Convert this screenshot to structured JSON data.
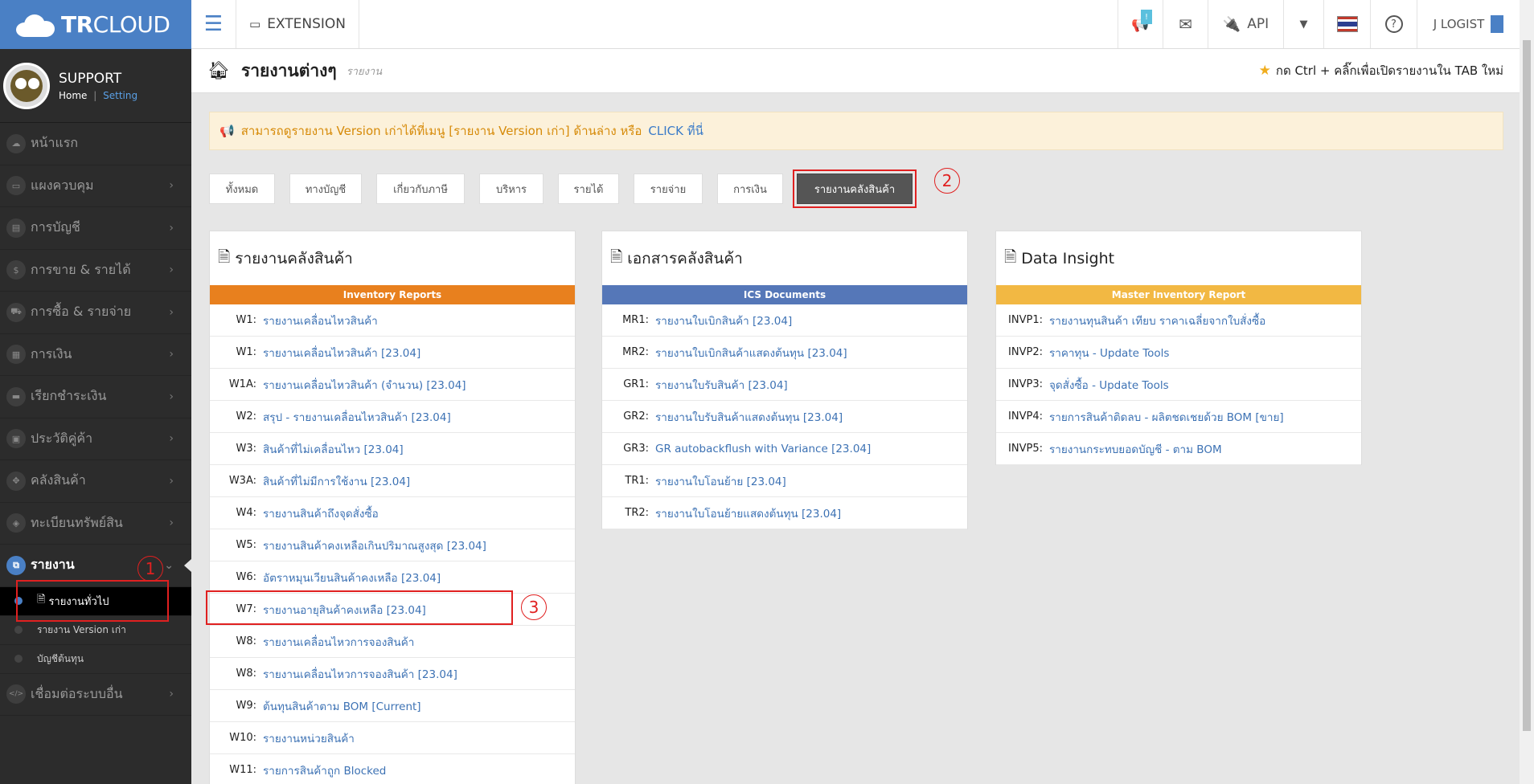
{
  "brand": {
    "bold": "TR",
    "rest": "CLOUD"
  },
  "topbar": {
    "extension": "EXTENSION",
    "badge": "!",
    "api": "API",
    "user": "J LOGIST"
  },
  "sidebar": {
    "user_name": "SUPPORT",
    "home": "Home",
    "sep": "|",
    "setting": "Setting",
    "items": [
      {
        "label": "หน้าแรก",
        "icon": "☁",
        "arrow": ""
      },
      {
        "label": "แผงควบคุม",
        "icon": "▭",
        "arrow": "›"
      },
      {
        "label": "การบัญชี",
        "icon": "▤",
        "arrow": "›"
      },
      {
        "label": "การขาย & รายได้",
        "icon": "$",
        "arrow": "›"
      },
      {
        "label": "การซื้อ & รายจ่าย",
        "icon": "⛟",
        "arrow": "›"
      },
      {
        "label": "การเงิน",
        "icon": "▦",
        "arrow": "›"
      },
      {
        "label": "เรียกชำระเงิน",
        "icon": "▬",
        "arrow": "›"
      },
      {
        "label": "ประวัติคู่ค้า",
        "icon": "▣",
        "arrow": "›"
      },
      {
        "label": "คลังสินค้า",
        "icon": "✥",
        "arrow": "›"
      },
      {
        "label": "ทะเบียนทรัพย์สิน",
        "icon": "◈",
        "arrow": "›"
      }
    ],
    "report": {
      "label": "รายงาน",
      "icon": "⧉",
      "arrow": "⌄"
    },
    "sub_items": [
      "รายงานทั่วไป",
      "รายงาน Version เก่า",
      "บัญชีต้นทุน"
    ],
    "last": {
      "label": "เชื่อมต่อระบบอื่น",
      "icon": "</>",
      "arrow": "›"
    }
  },
  "page": {
    "title": "รายงานต่างๆ",
    "subtitle": "รายงาน",
    "tip": "กด Ctrl + คลิ๊กเพื่อเปิดรายงานใน TAB ใหม่"
  },
  "alert": {
    "text": "สามารถดูรายงาน Version เก่าได้ที่เมนู [รายงาน Version เก่า] ด้านล่าง หรือ",
    "click": "CLICK ที่นี่"
  },
  "filters": [
    "ทั้งหมด",
    "ทางบัญชี",
    "เกี่ยวกับภาษี",
    "บริหาร",
    "รายได้",
    "รายจ่าย",
    "การเงิน",
    "รายงานคลังสินค้า"
  ],
  "annotations": [
    "1",
    "2",
    "3"
  ],
  "panels": [
    {
      "title": "รายงานคลังสินค้า",
      "band": "Inventory Reports",
      "color": "#e8801e",
      "rows": [
        {
          "code": "W1:",
          "label": "รายงานเคลื่อนไหวสินค้า"
        },
        {
          "code": "W1:",
          "label": "รายงานเคลื่อนไหวสินค้า [23.04]"
        },
        {
          "code": "W1A:",
          "label": "รายงานเคลื่อนไหวสินค้า (จำนวน) [23.04]"
        },
        {
          "code": "W2:",
          "label": "สรุป - รายงานเคลื่อนไหวสินค้า [23.04]"
        },
        {
          "code": "W3:",
          "label": "สินค้าที่ไม่เคลื่อนไหว [23.04]"
        },
        {
          "code": "W3A:",
          "label": "สินค้าที่ไม่มีการใช้งาน [23.04]"
        },
        {
          "code": "W4:",
          "label": "รายงานสินค้าถึงจุดสั่งซื้อ"
        },
        {
          "code": "W5:",
          "label": "รายงานสินค้าคงเหลือเกินปริมาณสูงสุด [23.04]"
        },
        {
          "code": "W6:",
          "label": "อัตราหมุนเวียนสินค้าคงเหลือ [23.04]"
        },
        {
          "code": "W7:",
          "label": "รายงานอายุสินค้าคงเหลือ [23.04]"
        },
        {
          "code": "W8:",
          "label": "รายงานเคลื่อนไหวการจองสินค้า"
        },
        {
          "code": "W8:",
          "label": "รายงานเคลื่อนไหวการจองสินค้า [23.04]"
        },
        {
          "code": "W9:",
          "label": "ต้นทุนสินค้าตาม BOM [Current]"
        },
        {
          "code": "W10:",
          "label": "รายงานหน่วยสินค้า"
        },
        {
          "code": "W11:",
          "label": "รายการสินค้าถูก Blocked"
        }
      ]
    },
    {
      "title": "เอกสารคลังสินค้า",
      "band": "ICS Documents",
      "color": "#5577b8",
      "rows": [
        {
          "code": "MR1:",
          "label": "รายงานใบเบิกสินค้า [23.04]"
        },
        {
          "code": "MR2:",
          "label": "รายงานใบเบิกสินค้าแสดงต้นทุน [23.04]"
        },
        {
          "code": "GR1:",
          "label": "รายงานใบรับสินค้า [23.04]"
        },
        {
          "code": "GR2:",
          "label": "รายงานใบรับสินค้าแสดงต้นทุน [23.04]"
        },
        {
          "code": "GR3:",
          "label": "GR autobackflush with Variance [23.04]"
        },
        {
          "code": "TR1:",
          "label": "รายงานใบโอนย้าย [23.04]"
        },
        {
          "code": "TR2:",
          "label": "รายงานใบโอนย้ายแสดงต้นทุน [23.04]"
        }
      ]
    },
    {
      "title": "Data Insight",
      "band": "Master Inventory Report",
      "color": "#f2b843",
      "rows": [
        {
          "code": "INVP1:",
          "label": "รายงานทุนสินค้า เทียบ ราคาเฉลี่ยจากใบสั่งซื้อ"
        },
        {
          "code": "INVP2:",
          "label": "ราคาทุน - Update Tools"
        },
        {
          "code": "INVP3:",
          "label": "จุดสั่งซื้อ - Update Tools"
        },
        {
          "code": "INVP4:",
          "label": "รายการสินค้าติดลบ - ผลิตชดเชยด้วย BOM [ขาย]"
        },
        {
          "code": "INVP5:",
          "label": "รายงานกระทบยอดบัญชี - ตาม BOM"
        }
      ]
    }
  ]
}
